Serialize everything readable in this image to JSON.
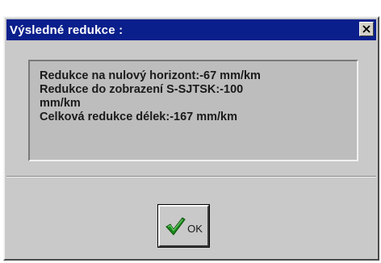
{
  "window": {
    "title": "Výsledné redukce :",
    "close_icon": "close-icon",
    "colors": {
      "titlebar": "#0a1f8c",
      "body": "#c9c9c9",
      "panel": "#bdbdbd"
    }
  },
  "message": {
    "lines": [
      "Redukce na nulový horizont:-67 mm/km",
      "Redukce do zobrazení S-SJTSK:-100\nmm/km",
      "Celková redukce délek:-167 mm/km"
    ]
  },
  "ok_button": {
    "label": "OK",
    "icon": "green-checkmark-icon",
    "icon_color": "#1a8a1a"
  }
}
